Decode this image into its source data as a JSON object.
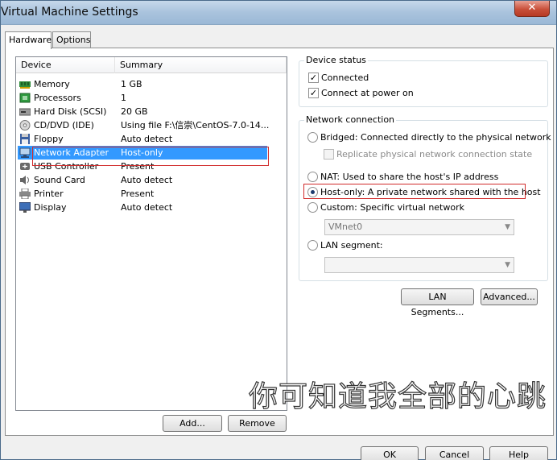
{
  "window": {
    "title": "Virtual Machine Settings",
    "close_label": "✕"
  },
  "tabs": [
    {
      "label": "Hardware"
    },
    {
      "label": "Options"
    }
  ],
  "device_list": {
    "headers": {
      "device": "Device",
      "summary": "Summary"
    },
    "rows": [
      {
        "name": "Memory",
        "summary": "1 GB",
        "icon": "memory-icon"
      },
      {
        "name": "Processors",
        "summary": "1",
        "icon": "processor-icon"
      },
      {
        "name": "Hard Disk (SCSI)",
        "summary": "20 GB",
        "icon": "hard-disk-icon"
      },
      {
        "name": "CD/DVD (IDE)",
        "summary": "Using file F:\\信崇\\CentOS-7.0-14...",
        "icon": "cd-dvd-icon"
      },
      {
        "name": "Floppy",
        "summary": "Auto detect",
        "icon": "floppy-icon"
      },
      {
        "name": "Network Adapter",
        "summary": "Host-only",
        "icon": "network-adapter-icon",
        "selected": true
      },
      {
        "name": "USB Controller",
        "summary": "Present",
        "icon": "usb-icon"
      },
      {
        "name": "Sound Card",
        "summary": "Auto detect",
        "icon": "sound-card-icon"
      },
      {
        "name": "Printer",
        "summary": "Present",
        "icon": "printer-icon"
      },
      {
        "name": "Display",
        "summary": "Auto detect",
        "icon": "display-icon"
      }
    ]
  },
  "list_buttons": {
    "add": "Add...",
    "remove": "Remove"
  },
  "device_status": {
    "title": "Device status",
    "connected": "Connected",
    "connect_at_power_on": "Connect at power on"
  },
  "network_connection": {
    "title": "Network connection",
    "bridged": "Bridged: Connected directly to the physical network",
    "replicate": "Replicate physical network connection state",
    "nat": "NAT: Used to share the host's IP address",
    "host_only": "Host-only: A private network shared with the host",
    "custom": "Custom: Specific virtual network",
    "custom_value": "VMnet0",
    "lan_segment": "LAN segment:",
    "lan_value": ""
  },
  "network_buttons": {
    "lan_segments": "LAN Segments...",
    "advanced": "Advanced..."
  },
  "dialog_buttons": {
    "ok": "OK",
    "cancel": "Cancel",
    "help": "Help"
  },
  "watermark": "你可知道我全部的心跳",
  "colors": {
    "selection": "#3399ff",
    "annotation_box": "#d12b2b"
  }
}
